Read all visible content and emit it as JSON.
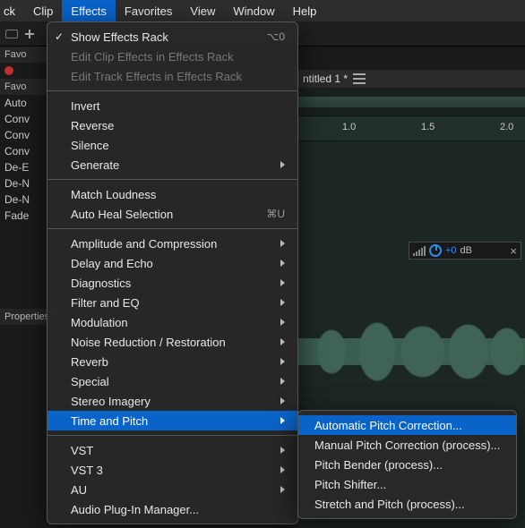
{
  "menubar": {
    "items": [
      {
        "label": "ck"
      },
      {
        "label": "Clip"
      },
      {
        "label": "Effects"
      },
      {
        "label": "Favorites"
      },
      {
        "label": "View"
      },
      {
        "label": "Window"
      },
      {
        "label": "Help"
      }
    ],
    "active_index": 2
  },
  "side_panel": {
    "header1": "Favo",
    "header2": "Favo",
    "items": [
      "Auto",
      "Conv",
      "Conv",
      "Conv",
      "De-E",
      "De-N",
      "De-N",
      "Fade"
    ],
    "properties_label": "Properties"
  },
  "tab": {
    "title": "ntitled 1 *"
  },
  "ruler": {
    "ticks": [
      "1.0",
      "1.5",
      "2.0"
    ]
  },
  "hud": {
    "value": "+0",
    "unit": "dB"
  },
  "effects_menu": {
    "groups": [
      [
        {
          "label": "Show Effects Rack",
          "checked": true,
          "shortcut": "⌥0"
        },
        {
          "label": "Edit Clip Effects in Effects Rack",
          "disabled": true
        },
        {
          "label": "Edit Track Effects in Effects Rack",
          "disabled": true
        }
      ],
      [
        {
          "label": "Invert"
        },
        {
          "label": "Reverse"
        },
        {
          "label": "Silence"
        },
        {
          "label": "Generate",
          "submenu": true
        }
      ],
      [
        {
          "label": "Match Loudness"
        },
        {
          "label": "Auto Heal Selection",
          "shortcut": "⌘U"
        }
      ],
      [
        {
          "label": "Amplitude and Compression",
          "submenu": true
        },
        {
          "label": "Delay and Echo",
          "submenu": true
        },
        {
          "label": "Diagnostics",
          "submenu": true
        },
        {
          "label": "Filter and EQ",
          "submenu": true
        },
        {
          "label": "Modulation",
          "submenu": true
        },
        {
          "label": "Noise Reduction / Restoration",
          "submenu": true
        },
        {
          "label": "Reverb",
          "submenu": true
        },
        {
          "label": "Special",
          "submenu": true
        },
        {
          "label": "Stereo Imagery",
          "submenu": true
        },
        {
          "label": "Time and Pitch",
          "submenu": true,
          "hover": true
        }
      ],
      [
        {
          "label": "VST",
          "submenu": true
        },
        {
          "label": "VST 3",
          "submenu": true
        },
        {
          "label": "AU",
          "submenu": true
        },
        {
          "label": "Audio Plug-In Manager..."
        }
      ]
    ]
  },
  "time_pitch_submenu": {
    "items": [
      {
        "label": "Automatic Pitch Correction...",
        "hover": true
      },
      {
        "label": "Manual Pitch Correction (process)..."
      },
      {
        "label": "Pitch Bender (process)..."
      },
      {
        "label": "Pitch Shifter..."
      },
      {
        "label": "Stretch and Pitch (process)..."
      }
    ]
  }
}
